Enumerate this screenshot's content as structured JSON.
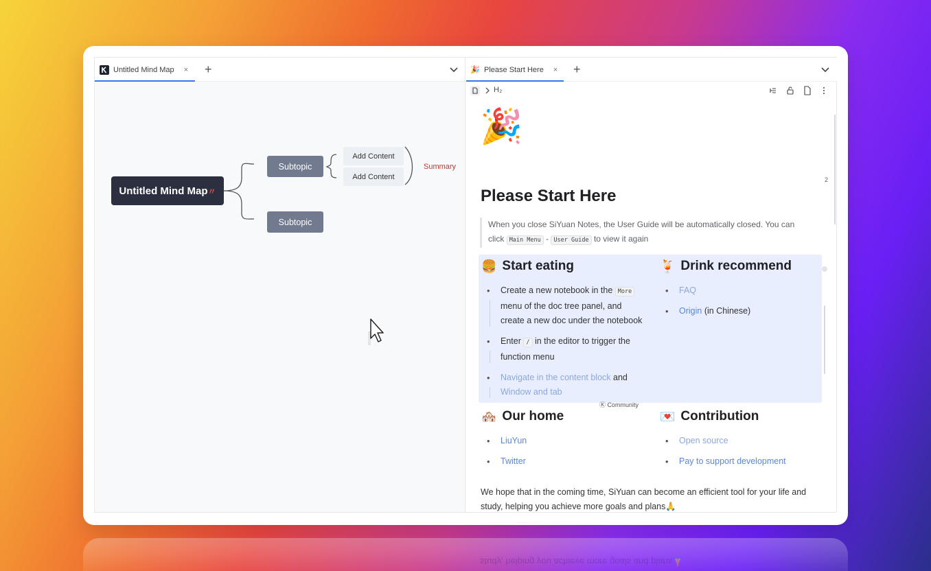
{
  "left_pane": {
    "tab": {
      "label": "Untitled Mind Map",
      "close": "×"
    },
    "new_tab": "+",
    "mindmap": {
      "root": "Untitled Mind Map",
      "root_emoji": "〃",
      "subtopics": [
        "Subtopic",
        "Subtopic"
      ],
      "contents": [
        "Add Content",
        "Add Content"
      ],
      "summary": "Summary"
    }
  },
  "right_pane": {
    "tab": {
      "emoji": "🎉",
      "label": "Please Start Here",
      "close": "×"
    },
    "new_tab": "+",
    "breadcrumb": {
      "heading": "H₂"
    },
    "doc": {
      "icon": "🎉",
      "title": "Please Start Here",
      "counter": "2",
      "quote": {
        "text_1": "When you close SiYuan Notes, the User Guide will be automatically closed. You can click",
        "kbd_1": "Main Menu",
        "sep": "-",
        "kbd_2": "User Guide",
        "text_2": "to view it again"
      },
      "start_eating": {
        "emoji": "🍔",
        "title": "Start eating",
        "item1_a": "Create a new notebook in the",
        "item1_kbd": "More",
        "item1_b": "menu of the doc tree panel, and create a new doc under the notebook",
        "item2_a": "Enter",
        "item2_kbd": "/",
        "item2_b": "in the editor to trigger the function menu",
        "item3_link": "Navigate in the content block",
        "item3_and": "and",
        "item3_link2": "Window and tab"
      },
      "drink": {
        "emoji": "🍹",
        "title": "Drink recommend",
        "item1": "FAQ",
        "item2_link": "Origin",
        "item2_rest": "(in Chinese)"
      },
      "community_label": "Community",
      "our_home": {
        "emoji": "🏘️",
        "title": "Our home",
        "items": [
          "LiuYun",
          "Twitter"
        ]
      },
      "contribution": {
        "emoji": "💌",
        "title": "Contribution",
        "items": [
          "Open source",
          "Pay to support development"
        ]
      },
      "closing": "We hope that in the coming time, SiYuan can become an efficient tool for your life and study, helping you achieve more goals and plans🙏"
    }
  },
  "reflection_text": "study, helping you achieve more goals and plans🙏"
}
